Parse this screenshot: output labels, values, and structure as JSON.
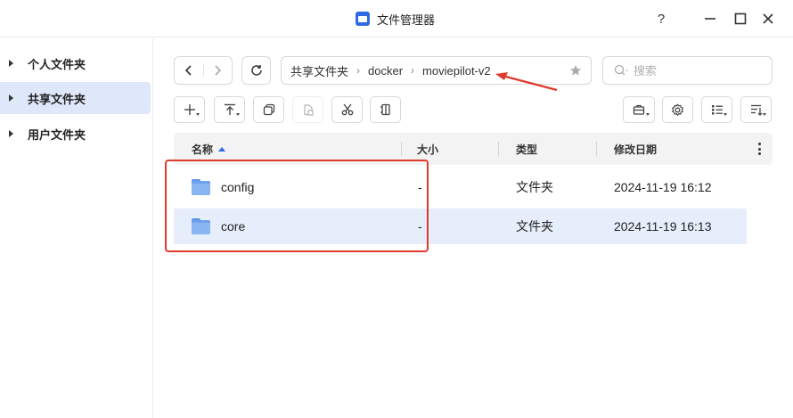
{
  "window": {
    "title": "文件管理器",
    "help_label": "?",
    "icons": {
      "app": "file-manager-icon",
      "minimize": "minimize-icon",
      "maximize": "maximize-icon",
      "close": "close-icon"
    }
  },
  "sidebar": {
    "items": [
      {
        "label": "个人文件夹",
        "active": false
      },
      {
        "label": "共享文件夹",
        "active": true
      },
      {
        "label": "用户文件夹",
        "active": false
      }
    ]
  },
  "breadcrumb": {
    "items": [
      "共享文件夹",
      "docker",
      "moviepilot-v2"
    ]
  },
  "search": {
    "placeholder": "搜索"
  },
  "table": {
    "columns": [
      "名称",
      "大小",
      "类型",
      "修改日期"
    ],
    "sort_column": "名称",
    "rows": [
      {
        "name": "config",
        "size": "-",
        "type": "文件夹",
        "modified": "2024-11-19 16:12",
        "selected": false
      },
      {
        "name": "core",
        "size": "-",
        "type": "文件夹",
        "modified": "2024-11-19 16:13",
        "selected": true
      }
    ]
  },
  "colors": {
    "accent": "#2d6be4",
    "selection": "#e6eefc",
    "sidebar_active": "#dfe8fb",
    "annotation": "#e23a2e"
  }
}
